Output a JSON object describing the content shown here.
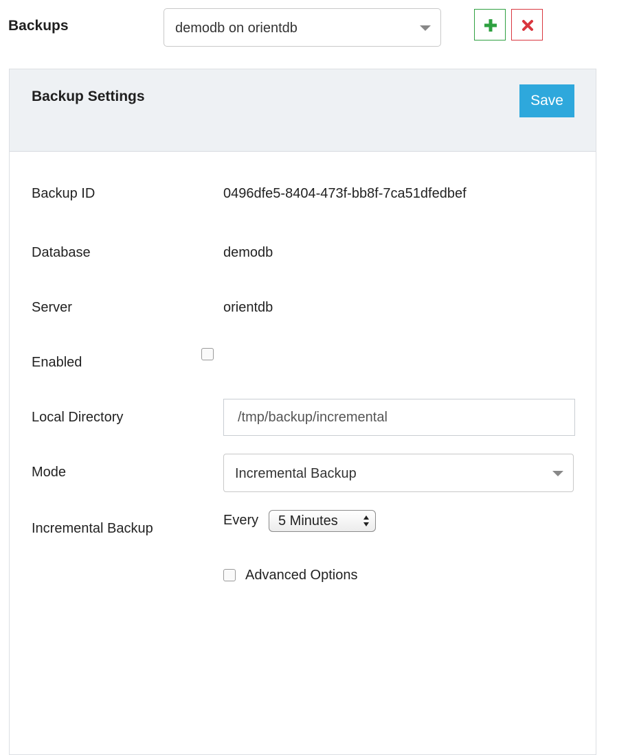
{
  "header": {
    "title": "Backups",
    "selected_backup": "demodb on orientdb",
    "add_icon": "plus-icon",
    "delete_icon": "close-icon"
  },
  "panel": {
    "title": "Backup Settings",
    "save_label": "Save"
  },
  "fields": {
    "backup_id_label": "Backup ID",
    "backup_id_value": "0496dfe5-8404-473f-bb8f-7ca51dfedbef",
    "database_label": "Database",
    "database_value": "demodb",
    "server_label": "Server",
    "server_value": "orientdb",
    "enabled_label": "Enabled",
    "enabled_checked": false,
    "local_directory_label": "Local Directory",
    "local_directory_value": "/tmp/backup/incremental",
    "mode_label": "Mode",
    "mode_value": "Incremental Backup",
    "incremental_label": "Incremental Backup",
    "every_label": "Every",
    "interval_value": "5 Minutes",
    "advanced_label": "Advanced Options",
    "advanced_checked": false
  },
  "colors": {
    "add": "#2ea040",
    "delete": "#d9363e",
    "save": "#2ea8dc",
    "header_bg": "#eef1f4"
  }
}
